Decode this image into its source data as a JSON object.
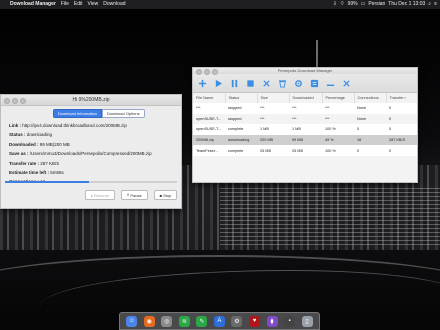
{
  "menubar": {
    "app": "Download Manager",
    "items": [
      "File",
      "Edit",
      "View",
      "Download"
    ],
    "battery": "99%",
    "user": "Persian",
    "clock": "Thu Dec 1  13:03"
  },
  "progress_window": {
    "title": "Hi 9%200MB.zip",
    "tabs": [
      "Download Information",
      "Download Options"
    ],
    "fields": [
      {
        "label": "Link :",
        "value": "http://ipv4.download.thinkbroadband.com/200MB.zip"
      },
      {
        "label": "Status :",
        "value": "downloading"
      },
      {
        "label": "Downloaded :",
        "value": "99 MB(200 MB"
      },
      {
        "label": "Save as :",
        "value": "/Users/mmu3/Downloads/Persepolis/Compressed/200MB.zip"
      },
      {
        "label": "Transfer rate :",
        "value": "287 KB/S"
      },
      {
        "label": "Estimate time left :",
        "value": "6m58s"
      },
      {
        "label": "Connections :",
        "value": "16"
      }
    ],
    "progress": 0.49,
    "buttons": {
      "resume": "Resume",
      "pause": "Pause",
      "stop": "Stop"
    }
  },
  "manager_window": {
    "title": "Persepolis Download Manager",
    "columns": [
      "File Name",
      "Status",
      "Size",
      "Downloaded",
      "Percentage",
      "Connections",
      "Transfer r"
    ],
    "rows": [
      [
        "***",
        "stopped",
        "***",
        "***",
        "***",
        "None",
        "0"
      ],
      [
        "openSUSE-T...",
        "stopped",
        "***",
        "***",
        "***",
        "None",
        "0"
      ],
      [
        "openSUSE-T...",
        "complete",
        "1 MB",
        "1 MB",
        "100 %",
        "0",
        "0"
      ],
      [
        "200MB.zip",
        "downloading",
        "200 MB",
        "99 MB",
        "49 %",
        "16",
        "287 KB/S"
      ],
      [
        "TeamFeser...",
        "complete",
        "25 MB",
        "25 MB",
        "100 %",
        "0",
        "0"
      ]
    ],
    "selected_row": 3
  },
  "colors": {
    "accent": "#3e7de6",
    "toolbar_icon": "#3b8fe0"
  }
}
